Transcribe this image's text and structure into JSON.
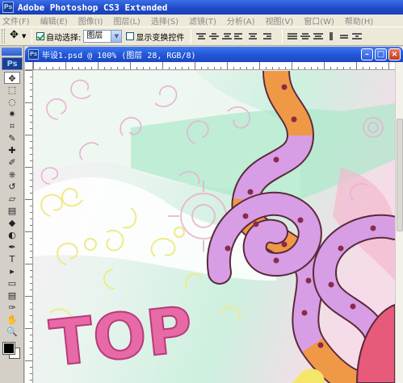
{
  "app": {
    "logo": "Ps",
    "title": "Adobe Photoshop CS3 Extended"
  },
  "menu": [
    "文件(F)",
    "编辑(E)",
    "图像(I)",
    "图层(L)",
    "选择(S)",
    "滤镜(T)",
    "分析(A)",
    "视图(V)",
    "窗口(W)",
    "帮助(H)"
  ],
  "options": {
    "auto_select_label": "自动选择:",
    "auto_select_checked": true,
    "auto_select_value": "图层",
    "show_transform_label": "显示变换控件",
    "show_transform_checked": false
  },
  "tools": [
    "move-tool",
    "marquee-tool",
    "lasso-tool",
    "magic-wand-tool",
    "crop-tool",
    "slice-tool",
    "healing-brush-tool",
    "brush-tool",
    "clone-stamp-tool",
    "history-brush-tool",
    "eraser-tool",
    "gradient-tool",
    "blur-tool",
    "dodge-tool",
    "pen-tool",
    "type-tool",
    "path-selection-tool",
    "shape-tool",
    "notes-tool",
    "eyedropper-tool",
    "hand-tool",
    "zoom-tool"
  ],
  "tool_glyphs": [
    "✥",
    "⬚",
    "◌",
    "✷",
    "⌗",
    "✎",
    "✚",
    "✐",
    "⎈",
    "↺",
    "▱",
    "▤",
    "◆",
    "◐",
    "✒",
    "T",
    "▸",
    "▭",
    "▤",
    "✑",
    "✋",
    "🔍"
  ],
  "colors": {
    "foreground": "#000000",
    "background": "#ffffff"
  },
  "document": {
    "title": "毕设1.psd @ 100% (图层 28, RGB/8)"
  },
  "artwork": {
    "text": "TOP"
  }
}
